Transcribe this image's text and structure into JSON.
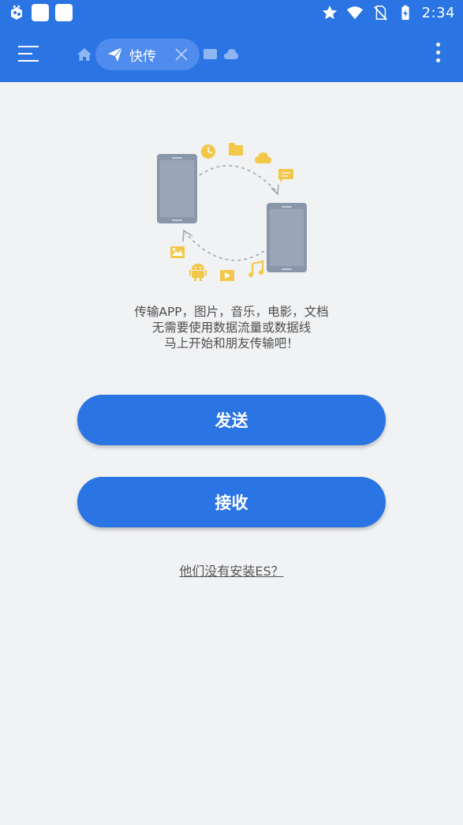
{
  "status_bar": {
    "time": "2:34",
    "icons": [
      "app-notification-icon",
      "square-notification-icon",
      "square-notification-icon",
      "star-icon",
      "wifi-icon",
      "no-sim-icon",
      "battery-charging-icon"
    ]
  },
  "toolbar": {
    "tab_label": "快传",
    "breadcrumb_icons": [
      "home-icon",
      "send-icon",
      "window-icon",
      "cloud-icon"
    ]
  },
  "main": {
    "description_lines": [
      "传输APP，图片，音乐，电影，文档",
      "无需要使用数据流量或数据线",
      "马上开始和朋友传输吧！"
    ],
    "send_label": "发送",
    "receive_label": "接收",
    "help_link": "他们没有安装ES？"
  },
  "colors": {
    "primary": "#2a74e4",
    "background": "#f1f2f4",
    "illustration_yellow": "#f3c84a",
    "phone_gray": "#8a97ab"
  }
}
